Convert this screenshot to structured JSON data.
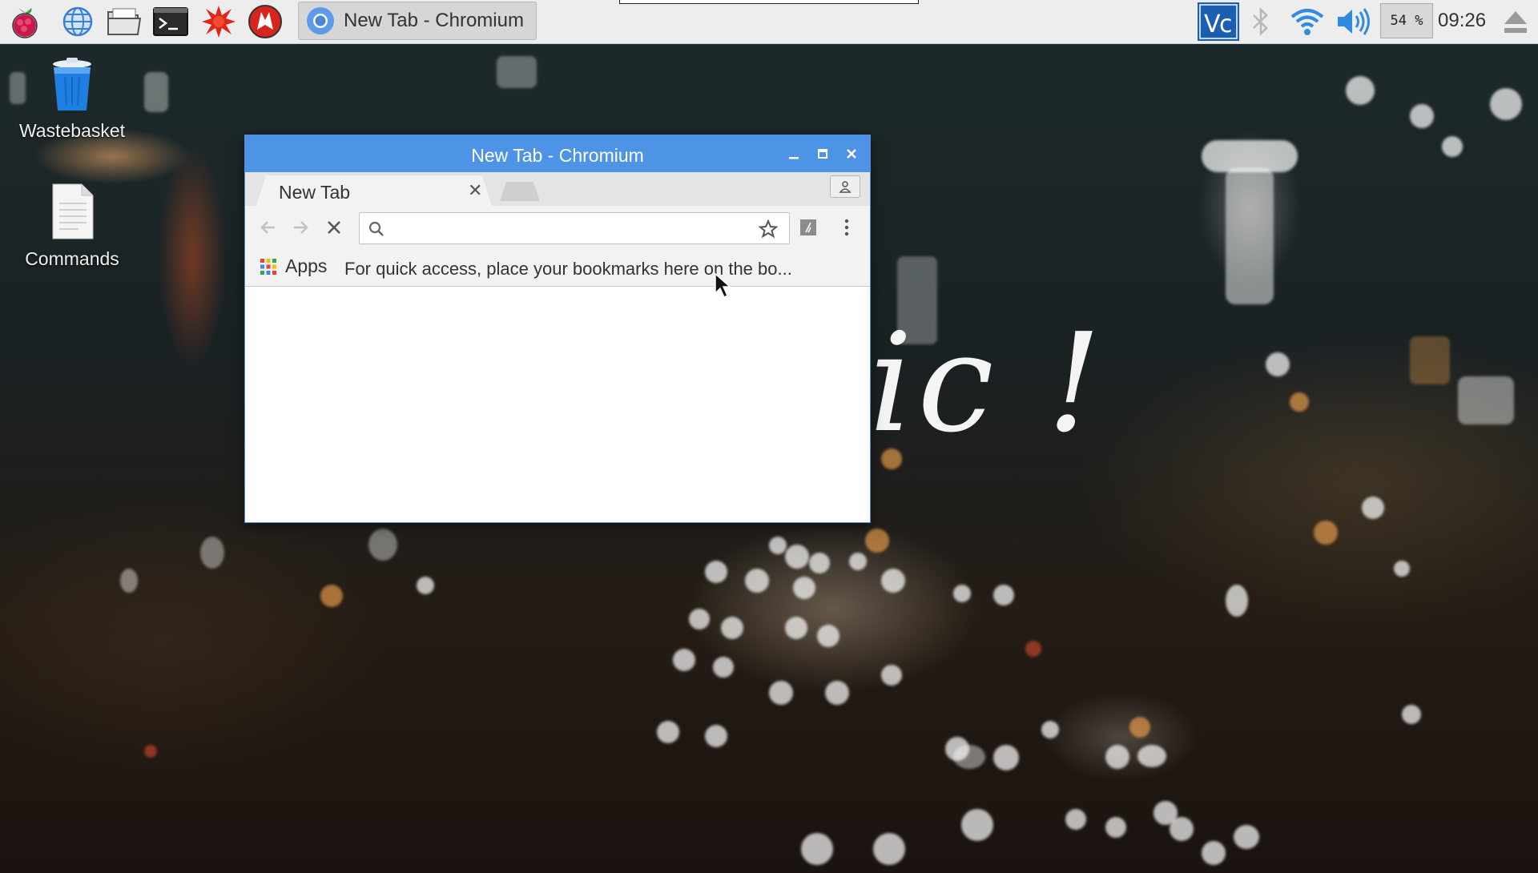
{
  "taskbar": {
    "launchers": [
      {
        "name": "menu",
        "icon": "raspberry-icon"
      },
      {
        "name": "web-browser",
        "icon": "globe-icon"
      },
      {
        "name": "file-manager",
        "icon": "folder-icon"
      },
      {
        "name": "terminal",
        "icon": "terminal-icon"
      },
      {
        "name": "mathematica",
        "icon": "star-burst-icon"
      },
      {
        "name": "wolfram",
        "icon": "wolf-icon"
      }
    ],
    "active_task": {
      "label": "New Tab - Chromium",
      "icon": "chromium-icon"
    },
    "tray": {
      "vnc_icon": "vnc-icon",
      "bluetooth_icon": "bluetooth-icon",
      "wifi_icon": "wifi-icon",
      "volume_icon": "volume-icon",
      "cpu_usage": "54 %",
      "clock": "09:26",
      "eject_icon": "eject-icon"
    }
  },
  "desktop": {
    "icons": [
      {
        "label": "Wastebasket",
        "icon": "trash-icon"
      },
      {
        "label": "Commands",
        "icon": "document-icon"
      }
    ],
    "wallpaper_text": "ic !"
  },
  "window": {
    "title": "New Tab - Chromium",
    "tabs": [
      {
        "title": "New Tab"
      }
    ],
    "omnibox": {
      "value": "",
      "placeholder": ""
    },
    "bookmarks_bar": {
      "apps_label": "Apps",
      "hint": "For quick access, place your bookmarks here on the bo..."
    }
  },
  "colors": {
    "titlebar": "#4e94e6",
    "taskbar": "#ededed",
    "accent": "#1f6fd1"
  }
}
